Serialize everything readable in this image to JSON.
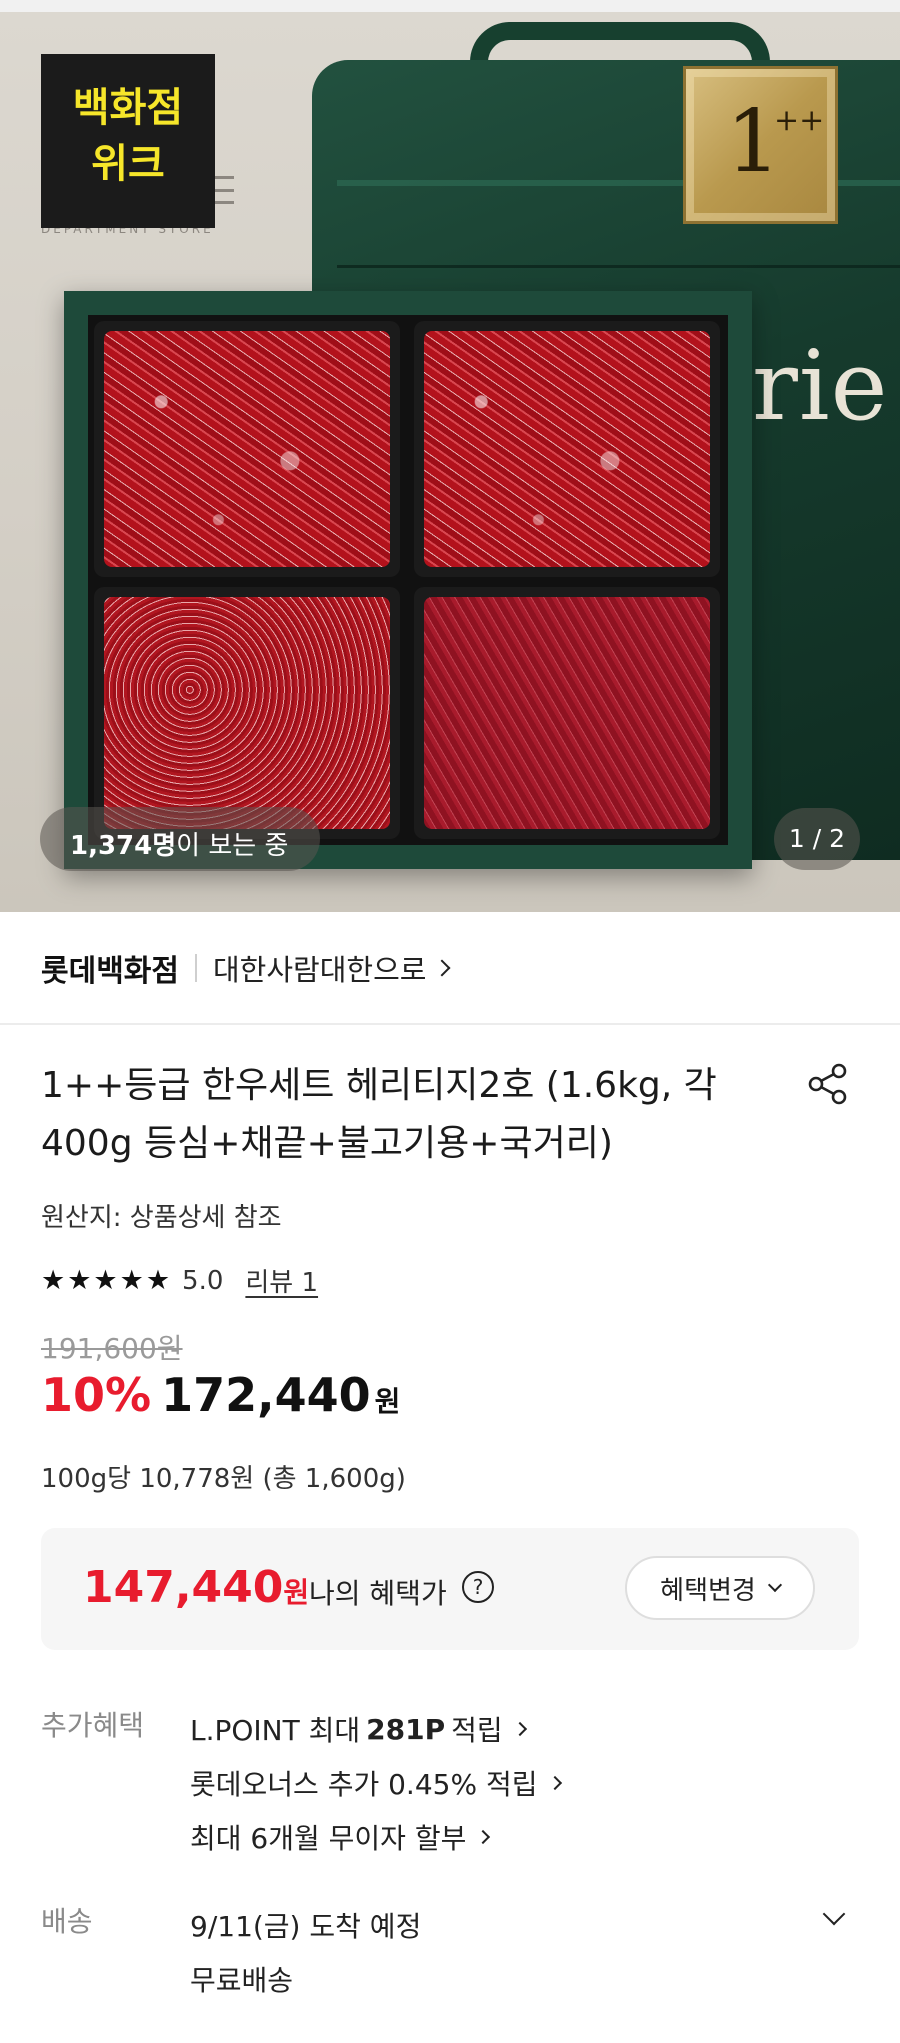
{
  "hero": {
    "logo_text_line1": "백화점",
    "logo_text_line2": "위크",
    "logo_sub": "DEPARTMENT STORE",
    "grade_badge_main": "1",
    "grade_badge_sup": "++",
    "bag_text": "rie",
    "viewers_count": "1,374명",
    "viewers_suffix": "이 보는 중",
    "pager": "1 / 2"
  },
  "store": {
    "name": "롯데백화점",
    "brand": "대한사람대한으로"
  },
  "product": {
    "title": "1++등급 한우세트 헤리티지2호 (1.6kg, 각 400g 등심+채끝+불고기용+국거리)",
    "origin": "원산지: 상품상세 참조",
    "stars": "★★★★★",
    "rating": "5.0",
    "review_link": "리뷰 1",
    "original_price": "191,600원",
    "discount": "10%",
    "price": "172,440",
    "price_unit": "원",
    "unit_price": "100g당 10,778원 (총 1,600g)"
  },
  "benefit": {
    "price": "147,440",
    "price_unit": "원",
    "label": "나의 혜택가",
    "help": "?",
    "button": "혜택변경"
  },
  "extra_benefits": {
    "label": "추가혜택",
    "items": [
      {
        "prefix": "L.POINT 최대",
        "bold": "281P",
        "suffix": "적립"
      },
      {
        "prefix": "롯데오너스 추가 0.45% 적립",
        "bold": "",
        "suffix": ""
      },
      {
        "prefix": "최대 6개월 무이자 할부",
        "bold": "",
        "suffix": ""
      }
    ]
  },
  "shipping": {
    "label": "배송",
    "arrival": "9/11(금) 도착 예정",
    "fee": "무료배송"
  },
  "colors": {
    "accent_red": "#e81c2e",
    "logo_yellow": "#f6e62a",
    "box_green": "#1e4a3a"
  },
  "icons": [
    "share-icon",
    "help-icon",
    "chevron-right-icon",
    "chevron-down-icon"
  ]
}
